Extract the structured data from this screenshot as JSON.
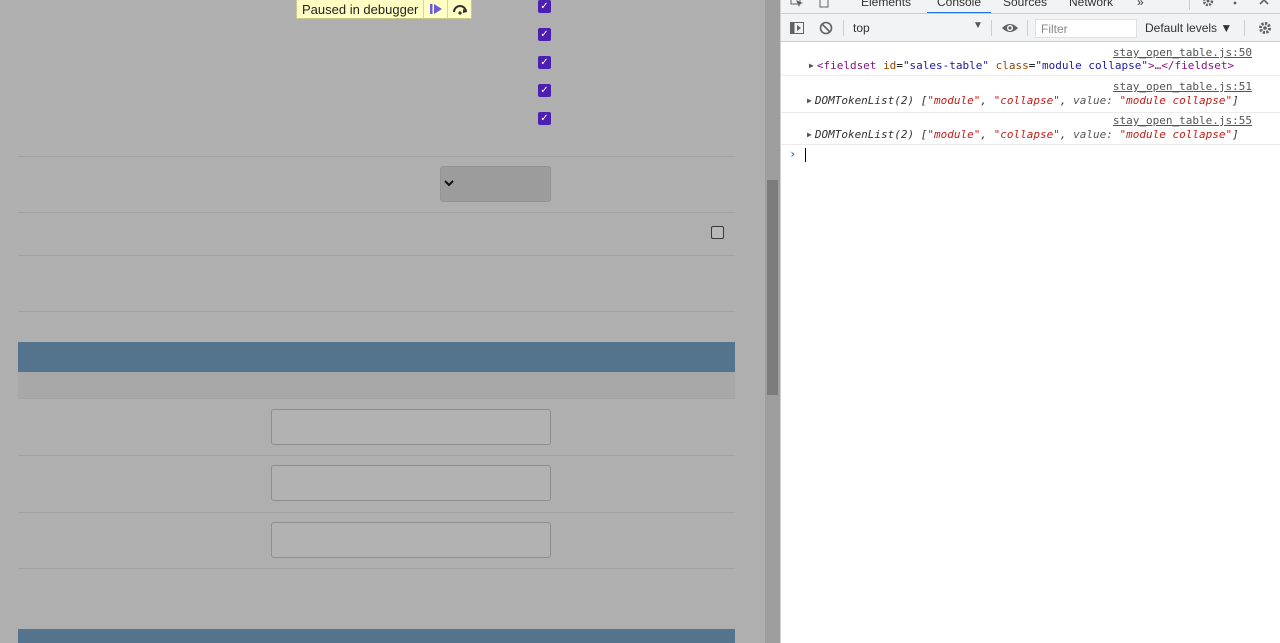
{
  "debugger": {
    "label": "Paused in debugger"
  },
  "devtools": {
    "tabs": [
      "Elements",
      "Console",
      "Sources",
      "Network"
    ],
    "active_tab": "Console",
    "more_tabs_glyph": "»",
    "context": "top",
    "filter_placeholder": "Filter",
    "levels": "Default levels ▼"
  },
  "console": {
    "messages": [
      {
        "source": "stay_open_table.js:50",
        "open_tag": "<fieldset",
        "attr1_name": "id",
        "attr1_value": "\"sales-table\"",
        "attr2_name": "class",
        "attr2_value": "\"module collapse\"",
        "tail": ">…</fieldset>"
      },
      {
        "source": "stay_open_table.js:51",
        "prefix": "DOMTokenList(2) [",
        "item1": "\"module\"",
        "item2": "\"collapse\"",
        "value_key": "value:",
        "value": "\"module collapse\"",
        "suffix": "]"
      },
      {
        "source": "stay_open_table.js:55",
        "prefix": "DOMTokenList(2) [",
        "item1": "\"module\"",
        "item2": "\"collapse\"",
        "value_key": "value:",
        "value": "\"module collapse\"",
        "suffix": "]"
      }
    ],
    "prompt": "›"
  }
}
